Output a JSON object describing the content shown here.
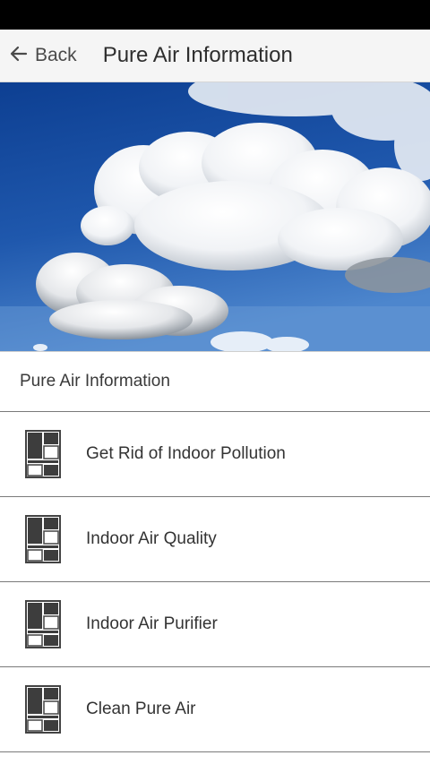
{
  "appbar": {
    "back_icon": "arrow-left-icon",
    "back_label": "Back",
    "title": "Pure Air Information"
  },
  "hero": {
    "subject": "sky-clouds-photo"
  },
  "section": {
    "header": "Pure Air Information"
  },
  "list": {
    "icon": "layout-blocks-icon",
    "items": [
      {
        "label": "Get Rid of Indoor Pollution"
      },
      {
        "label": "Indoor Air Quality"
      },
      {
        "label": "Indoor Air Purifier"
      },
      {
        "label": "Clean Pure Air"
      }
    ]
  },
  "colors": {
    "status_bar": "#000000",
    "app_bar": "#f5f5f5",
    "sky": "#1e4f9e",
    "divider": "#7a7a7a"
  }
}
